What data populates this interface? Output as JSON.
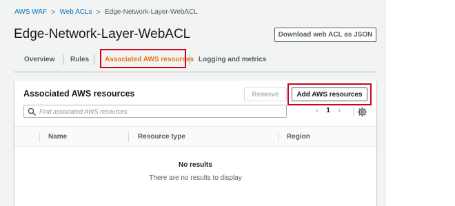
{
  "breadcrumb": {
    "items": [
      "AWS WAF",
      "Web ACLs",
      "Edge-Network-Layer-WebACL"
    ],
    "separator": ">"
  },
  "page": {
    "title": "Edge-Network-Layer-WebACL",
    "download_label": "Download web ACL as JSON"
  },
  "tabs": [
    {
      "label": "Overview",
      "active": false
    },
    {
      "label": "Rules",
      "active": false
    },
    {
      "label": "Associated AWS resources",
      "active": true
    },
    {
      "label": "Logging and metrics",
      "active": false
    }
  ],
  "panel": {
    "title": "Associated AWS resources",
    "remove_label": "Remove",
    "add_label": "Add AWS resources",
    "search_placeholder": "Find associated AWS resources",
    "page_number": "1",
    "columns": [
      "Name",
      "Resource type",
      "Region"
    ],
    "empty_title": "No results",
    "empty_message": "There are no results to display"
  },
  "icons": {
    "search": "search-icon",
    "prev": "chevron-left-icon",
    "next": "chevron-right-icon",
    "settings": "gear-icon"
  },
  "colors": {
    "link": "#0073bb",
    "active_tab": "#ec7211",
    "highlight": "#d0021b",
    "background": "#f2f3f3"
  }
}
